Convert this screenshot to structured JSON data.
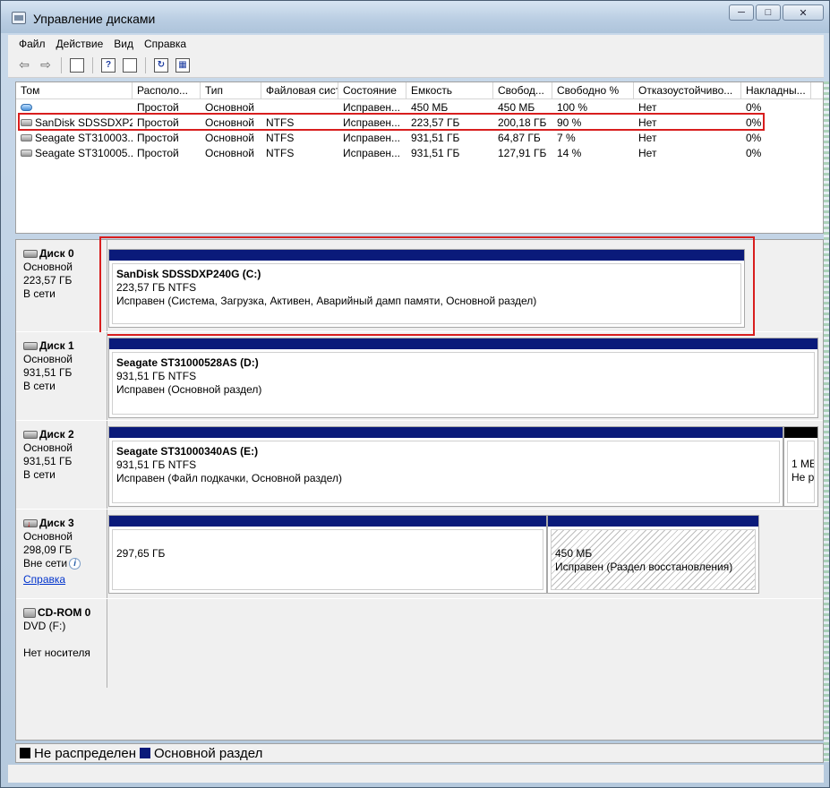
{
  "window": {
    "title": "Управление дисками",
    "buttons": {
      "minimize": "─",
      "maximize": "□",
      "close": "✕"
    }
  },
  "menu": [
    "Файл",
    "Действие",
    "Вид",
    "Справка"
  ],
  "toolbar": {
    "back_icon": "arrow-left-icon",
    "forward_icon": "arrow-right-icon",
    "help_label": "?"
  },
  "volumes": {
    "columns": [
      "Том",
      "Располо...",
      "Тип",
      "Файловая сист...",
      "Состояние",
      "Емкость",
      "Свобод...",
      "Свободно %",
      "Отказоустойчиво...",
      "Накладны..."
    ],
    "rows": [
      {
        "name": "",
        "layout": "Простой",
        "type": "Основной",
        "fs": "",
        "status": "Исправен...",
        "capacity": "450 МБ",
        "free": "450 МБ",
        "free_pct": "100 %",
        "fault": "Нет",
        "overhead": "0%",
        "icon": "blue"
      },
      {
        "name": "SanDisk SDSSDXP2...",
        "layout": "Простой",
        "type": "Основной",
        "fs": "NTFS",
        "status": "Исправен...",
        "capacity": "223,57 ГБ",
        "free": "200,18 ГБ",
        "free_pct": "90 %",
        "fault": "Нет",
        "overhead": "0%",
        "icon": "gray"
      },
      {
        "name": "Seagate ST310003...",
        "layout": "Простой",
        "type": "Основной",
        "fs": "NTFS",
        "status": "Исправен...",
        "capacity": "931,51 ГБ",
        "free": "64,87 ГБ",
        "free_pct": "7 %",
        "fault": "Нет",
        "overhead": "0%",
        "icon": "gray"
      },
      {
        "name": "Seagate ST310005...",
        "layout": "Простой",
        "type": "Основной",
        "fs": "NTFS",
        "status": "Исправен...",
        "capacity": "931,51 ГБ",
        "free": "127,91 ГБ",
        "free_pct": "14 %",
        "fault": "Нет",
        "overhead": "0%",
        "icon": "gray"
      }
    ]
  },
  "disks": {
    "disk0": {
      "name": "Диск 0",
      "type": "Основной",
      "size": "223,57 ГБ",
      "state": "В сети",
      "partition": {
        "title": "SanDisk SDSSDXP240G  (C:)",
        "size_fs": "223,57 ГБ NTFS",
        "status": "Исправен (Система, Загрузка, Активен, Аварийный дамп памяти, Основной раздел)"
      }
    },
    "disk1": {
      "name": "Диск 1",
      "type": "Основной",
      "size": "931,51 ГБ",
      "state": "В сети",
      "partition": {
        "title": "Seagate ST31000528AS  (D:)",
        "size_fs": "931,51 ГБ NTFS",
        "status": "Исправен (Основной раздел)"
      }
    },
    "disk2": {
      "name": "Диск 2",
      "type": "Основной",
      "size": "931,51 ГБ",
      "state": "В сети",
      "partition": {
        "title": "Seagate ST31000340AS  (E:)",
        "size_fs": "931,51 ГБ NTFS",
        "status": "Исправен (Файл подкачки, Основной раздел)"
      },
      "unallocated": {
        "line1": "1 МБ",
        "line2": "Не р"
      }
    },
    "disk3": {
      "name": "Диск 3",
      "type": "Основной",
      "size": "298,09 ГБ",
      "state": "Вне сети",
      "help_link": "Справка",
      "partition_a": {
        "size": "297,65 ГБ"
      },
      "partition_b": {
        "size": "450 МБ",
        "status": "Исправен (Раздел восстановления)"
      }
    },
    "cdrom": {
      "name": "CD-ROM 0",
      "drive": "DVD (F:)",
      "state": "Нет носителя"
    }
  },
  "legend": {
    "unallocated": "Не распределен",
    "primary": "Основной раздел",
    "colors": {
      "unallocated": "#000000",
      "primary": "#0a1a7a"
    }
  }
}
